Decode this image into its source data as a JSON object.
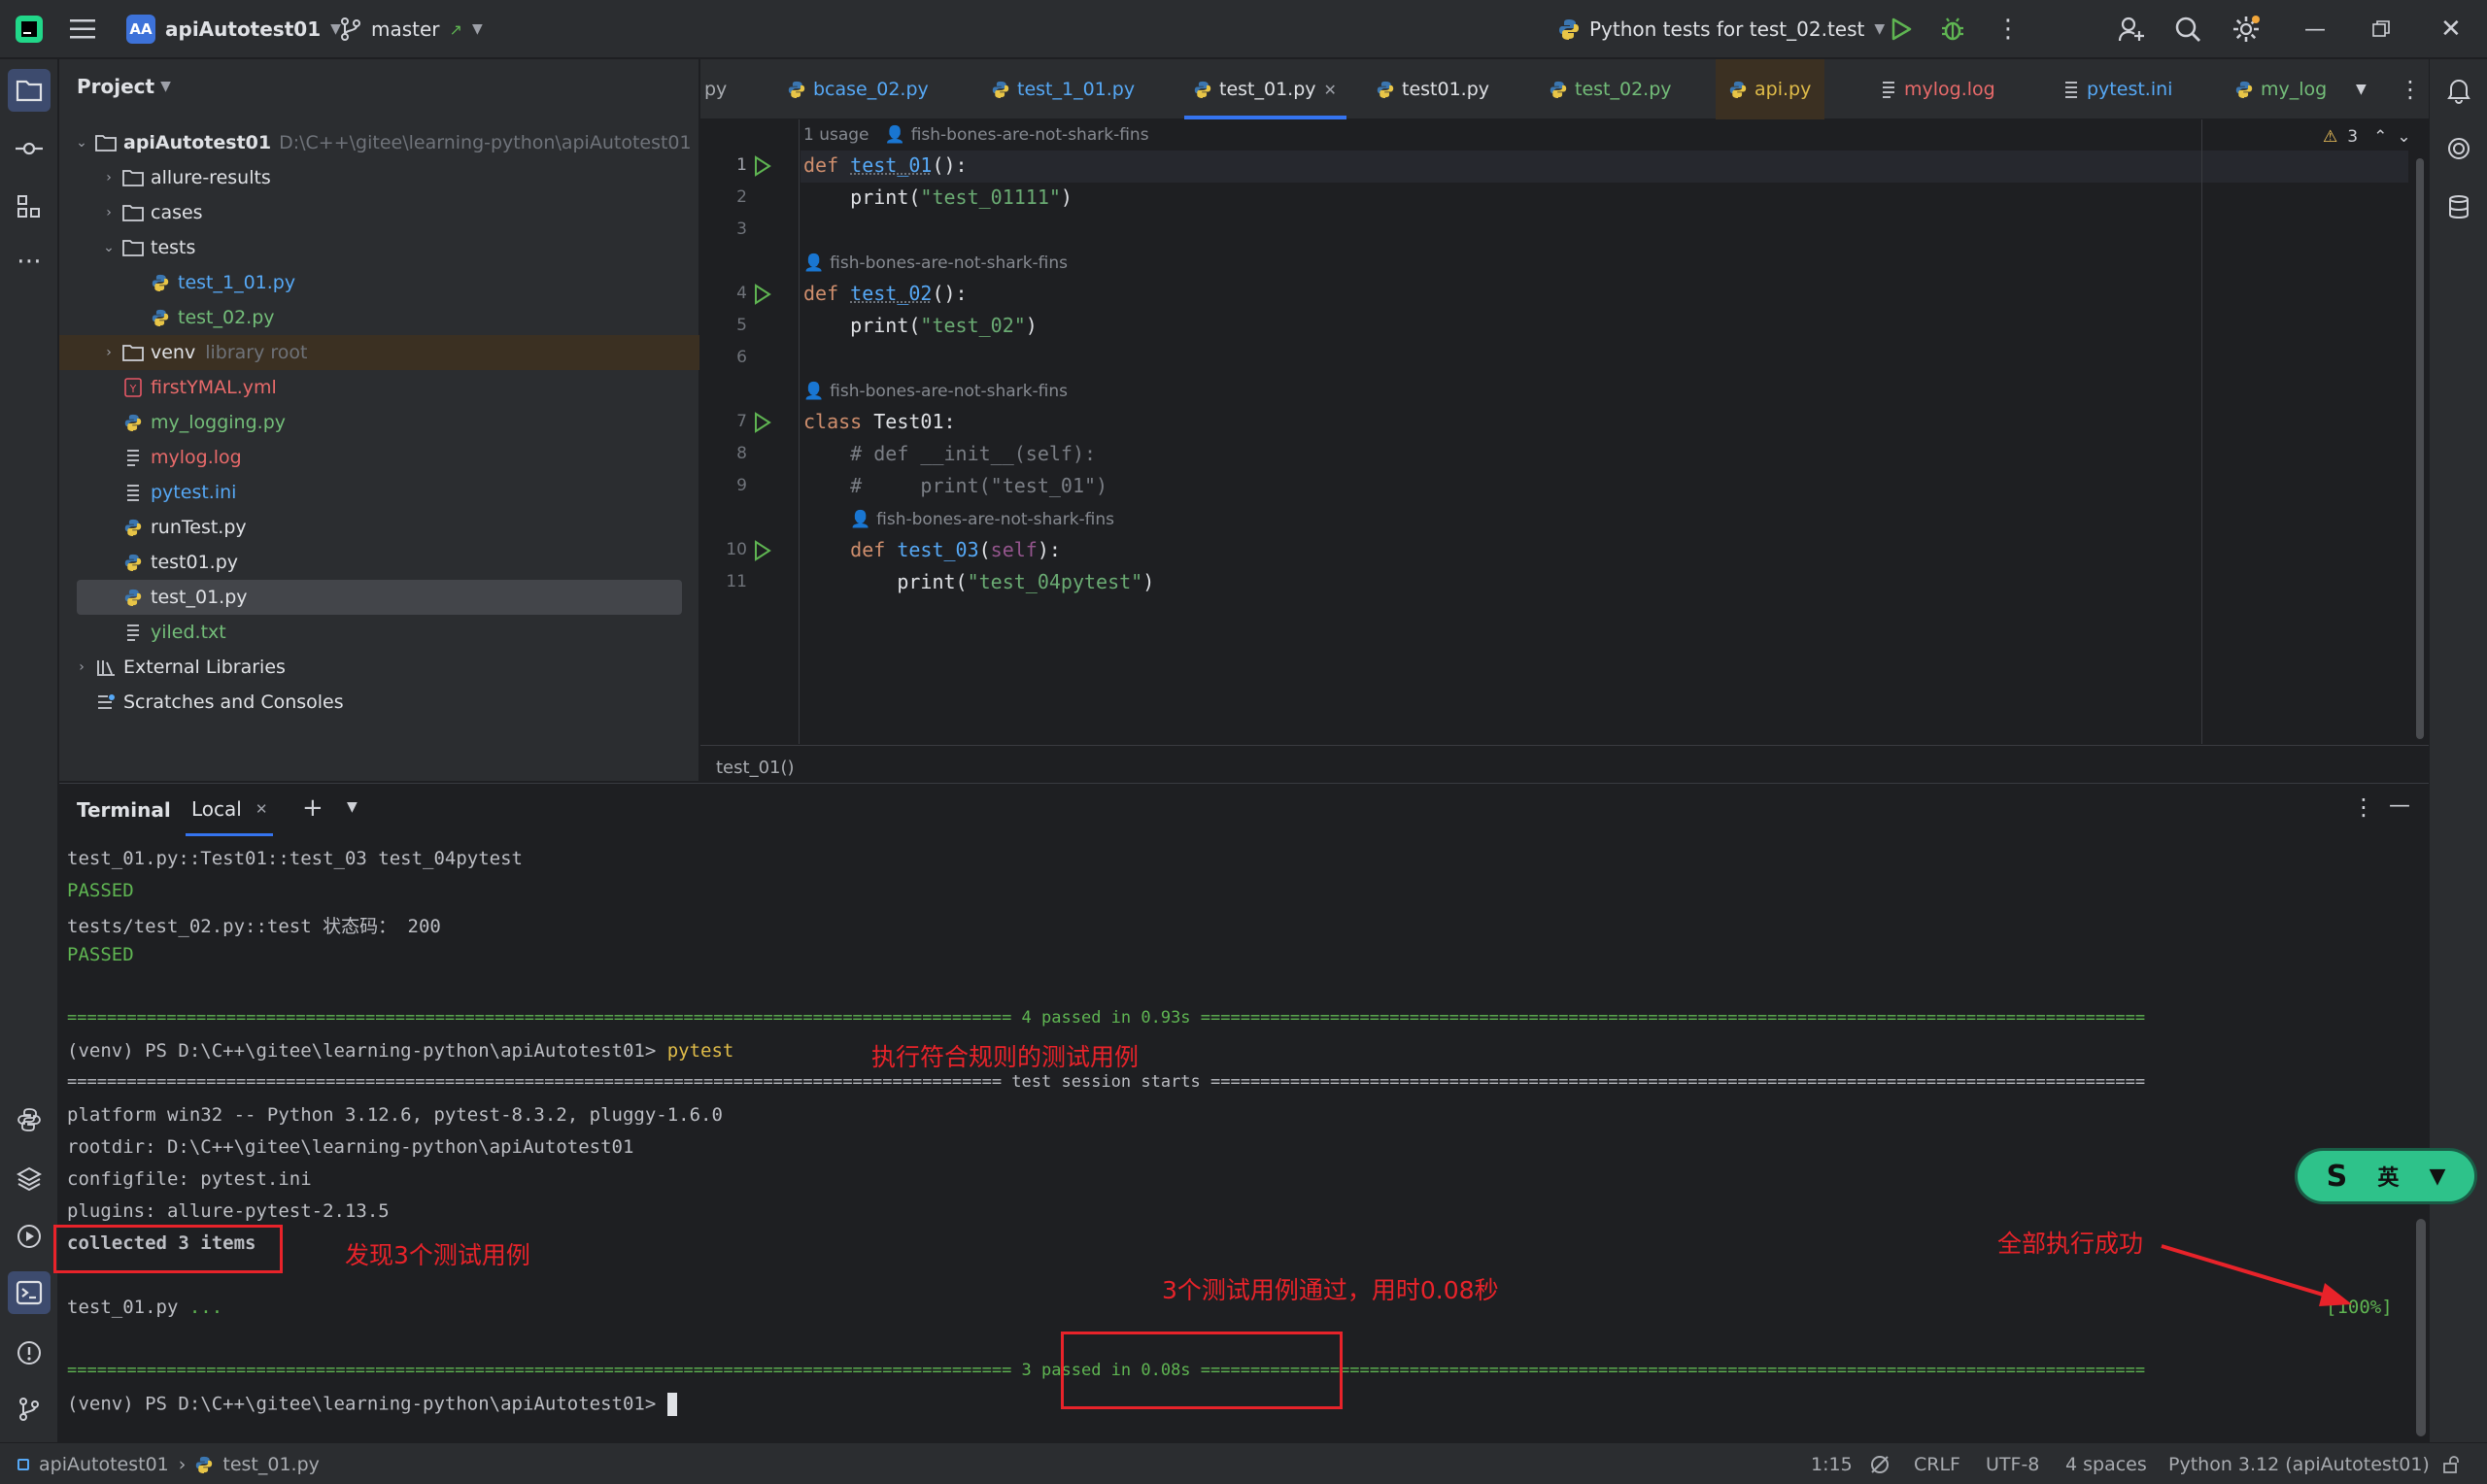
{
  "window": {
    "project_badge": "AA",
    "project_name": "apiAutotest01",
    "branch": "master",
    "run_config": "Python tests for test_02.test"
  },
  "project_panel": {
    "title": "Project",
    "root_name": "apiAutotest01",
    "root_path": "D:\\C++\\gitee\\learning-python\\apiAutotest01",
    "items": [
      {
        "label": "allure-results"
      },
      {
        "label": "cases"
      },
      {
        "label": "tests"
      },
      {
        "label": "test_1_01.py"
      },
      {
        "label": "test_02.py"
      },
      {
        "label": "venv",
        "sub": "library root"
      },
      {
        "label": "firstYMAL.yml"
      },
      {
        "label": "my_logging.py"
      },
      {
        "label": "mylog.log"
      },
      {
        "label": "pytest.ini"
      },
      {
        "label": "runTest.py"
      },
      {
        "label": "test01.py"
      },
      {
        "label": "test_01.py"
      },
      {
        "label": "yiled.txt"
      },
      {
        "label": "External Libraries"
      },
      {
        "label": "Scratches and Consoles"
      }
    ]
  },
  "editor": {
    "tabs": [
      {
        "label": "py"
      },
      {
        "label": "bcase_02.py"
      },
      {
        "label": "test_1_01.py"
      },
      {
        "label": "test_01.py"
      },
      {
        "label": "test01.py"
      },
      {
        "label": "test_02.py"
      },
      {
        "label": "api.py"
      },
      {
        "label": "mylog.log"
      },
      {
        "label": "pytest.ini"
      },
      {
        "label": "my_log"
      }
    ],
    "warnings_count": "3",
    "hints": {
      "usage": "1 usage",
      "author": "fish-bones-are-not-shark-fins"
    },
    "line_numbers": [
      "1",
      "2",
      "3",
      "4",
      "5",
      "6",
      "7",
      "8",
      "9",
      "10",
      "11"
    ],
    "code": {
      "l1_kw": "def ",
      "l1_fn": "test_01",
      "l1_rest": "():",
      "l2_pre": "    print(",
      "l2_str": "\"test_01111\"",
      "l2_post": ")",
      "l4_kw": "def ",
      "l4_fn": "test_02",
      "l4_rest": "():",
      "l5_pre": "    print(",
      "l5_str": "\"test_02\"",
      "l5_post": ")",
      "l7_kw": "class ",
      "l7_name": "Test01:",
      "l8": "    # def __init__(self):",
      "l9": "    #     print(\"test_01\")",
      "l10_kw": "    def ",
      "l10_fn": "test_03",
      "l10_open": "(",
      "l10_self": "self",
      "l10_close": "):",
      "l11_pre": "        print(",
      "l11_str": "\"test_04pytest\"",
      "l11_post": ")"
    },
    "breadcrumb": "test_01()"
  },
  "terminal": {
    "title": "Terminal",
    "tab_local": "Local",
    "lines": {
      "t1": "test_01.py::Test01::test_03 test_04pytest",
      "t2": "PASSED",
      "t3": "tests/test_02.py::test 状态码： 200",
      "t4": "PASSED",
      "t5": "=============================================================================================== 4 passed in 0.93s ===============================================================================================",
      "t6_prompt": "(venv) PS D:\\C++\\gitee\\learning-python\\apiAutotest01> ",
      "t6_cmd": "pytest",
      "t7": "============================================================================================== test session starts ==============================================================================================",
      "t8": "platform win32 -- Python 3.12.6, pytest-8.3.2, pluggy-1.6.0",
      "t9": "rootdir: D:\\C++\\gitee\\learning-python\\apiAutotest01",
      "t10": "configfile: pytest.ini",
      "t11": "plugins: allure-pytest-2.13.5",
      "t12": "collected 3 items",
      "t13_file": "test_01.py ",
      "t13_dots": "...",
      "t13_pct": "[100%]",
      "t14": "=============================================================================================== 3 passed in 0.08s ===============================================================================================",
      "t15": "(venv) PS D:\\C++\\gitee\\learning-python\\apiAutotest01> "
    },
    "annotations": {
      "a1": "执行符合规则的测试用例",
      "a2": "发现3个测试用例",
      "a3": "3个测试用例通过，用时0.08秒",
      "a4": "全部执行成功"
    },
    "ime": "英"
  },
  "status_bar": {
    "crumb_project": "apiAutotest01",
    "crumb_file": "test_01.py",
    "position": "1:15",
    "line_ending": "CRLF",
    "encoding": "UTF-8",
    "indent": "4 spaces",
    "interpreter": "Python 3.12 (apiAutotest01)"
  },
  "colors": {
    "accent": "#3574f0",
    "annotation_red": "#e8232a",
    "pass_green": "#5fb552"
  }
}
